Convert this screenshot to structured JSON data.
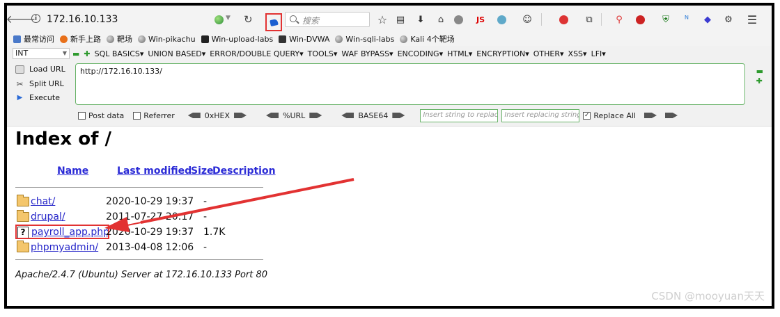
{
  "urlbar": {
    "url": "172.16.10.133",
    "search_placeholder": "搜索"
  },
  "toolbar_icons": {
    "js_label": "JS"
  },
  "bookmarks": [
    {
      "label": "最常访问",
      "icon": "bookmark-icon",
      "color": "#4a79c9"
    },
    {
      "label": "新手上路",
      "icon": "firefox-icon",
      "color": "#e8701a"
    },
    {
      "label": "靶场",
      "icon": "globe-icon"
    },
    {
      "label": "Win-pikachu",
      "icon": "globe-icon"
    },
    {
      "label": "Win-upload-labs",
      "icon": "dark-app-icon",
      "color": "#222222"
    },
    {
      "label": "Win-DVWA",
      "icon": "dvwa-icon",
      "color": "#333333"
    },
    {
      "label": "Win-sqli-labs",
      "icon": "globe-icon"
    },
    {
      "label": "Kali 4个靶场",
      "icon": "globe-icon"
    }
  ],
  "hackbar": {
    "sql_type": "INT",
    "menus": [
      "SQL BASICS▾",
      "UNION BASED▾",
      "ERROR/DOUBLE QUERY▾",
      "TOOLS▾",
      "WAF BYPASS▾",
      "ENCODING▾",
      "HTML▾",
      "ENCRYPTION▾",
      "OTHER▾",
      "XSS▾",
      "LFI▾"
    ],
    "load_url": "Load URL",
    "split_url": "Split URL",
    "execute": "Execute",
    "url_value": "http://172.16.10.133/",
    "post_data": "Post data",
    "referrer": "Referrer",
    "hex": "0xHEX",
    "urlenc": "%URL",
    "base64": "BASE64",
    "insert_string_placeholder": "Insert string to replace",
    "insert_replacing_placeholder": "Insert replacing string",
    "replace_all": "Replace All",
    "replace_all_checked": true
  },
  "page": {
    "title": "Index of /",
    "headers": {
      "name": "Name",
      "last_modified": "Last modified",
      "size": "Size",
      "description": "Description"
    },
    "entries": [
      {
        "name": "chat/",
        "date": "2020-10-29 19:37",
        "size": "-",
        "type": "folder"
      },
      {
        "name": "drupal/",
        "date": "2011-07-27 20:17",
        "size": "-",
        "type": "folder"
      },
      {
        "name": "payroll_app.php",
        "date": "2020-10-29 19:37",
        "size": "1.7K",
        "type": "file"
      },
      {
        "name": "phpmyadmin/",
        "date": "2013-04-08 12:06",
        "size": "-",
        "type": "folder"
      }
    ],
    "server_signature": "Apache/2.4.7 (Ubuntu) Server at 172.16.10.133 Port 80"
  },
  "annotation": {
    "highlight_color": "#e23232"
  },
  "watermark": "CSDN @mooyuan天天"
}
